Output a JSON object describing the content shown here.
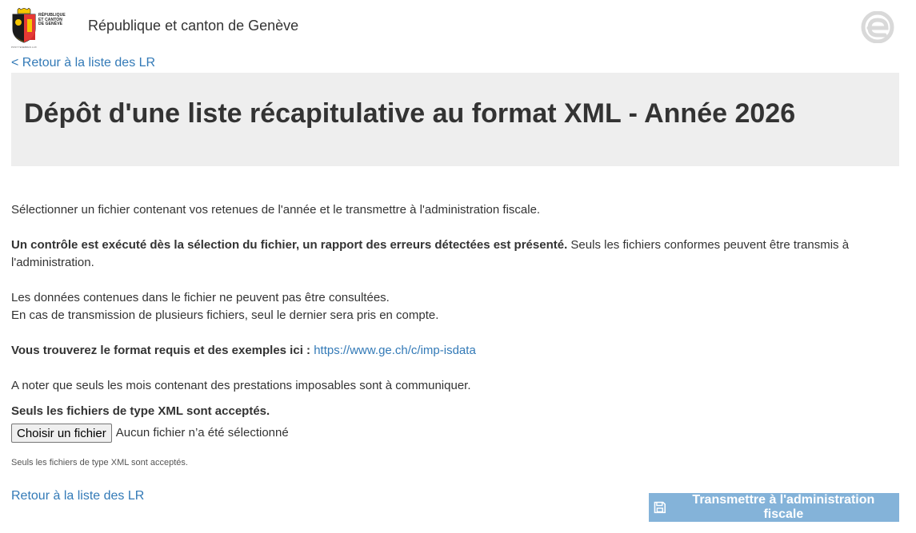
{
  "header": {
    "logo_text_lines": [
      "RÉPUBLIQUE",
      "ET CANTON",
      "DE GENÈVE"
    ],
    "logo_sub": "POST TENEBRAS LUX",
    "site_title": "République et canton de Genève",
    "right_icon": "e-logo-icon"
  },
  "nav": {
    "back_top": "< Retour à la liste des LR",
    "back_bottom": "Retour à la liste des LR"
  },
  "banner": {
    "title": "Dépôt d'une liste récapitulative au format XML - Année 2026"
  },
  "content": {
    "intro": "Sélectionner un fichier contenant vos retenues de l'année et le transmettre à l'administration fiscale.",
    "control_bold": "Un contrôle est exécuté dès la sélection du fichier, un rapport des erreurs détectées est présenté.",
    "control_rest": " Seuls les fichiers conformes peuvent être transmis à l'administration.",
    "data_line1": "Les données contenues dans le fichier ne peuvent pas être consultées.",
    "data_line2": "En cas de transmission de plusieurs fichiers, seul le dernier sera pris en compte.",
    "format_bold": "Vous trouverez le format requis et des exemples ici :",
    "format_link": "https://www.ge.ch/c/imp-isdata",
    "note": "A noter que seuls les mois contenant des prestations imposables sont à communiquer.",
    "accept_label": "Seuls les fichiers de type XML sont acceptés.",
    "file_button": "Choisir un fichier",
    "file_status": "Aucun fichier n’a été sélectionné",
    "help_small": "Seuls les fichiers de type XML sont acceptés."
  },
  "submit": {
    "label": "Transmettre à l'administration fiscale",
    "icon": "save-icon",
    "color": "#84b3d9"
  },
  "colors": {
    "link": "#337ab7",
    "banner_bg": "#eeeeee",
    "text": "#333333"
  }
}
